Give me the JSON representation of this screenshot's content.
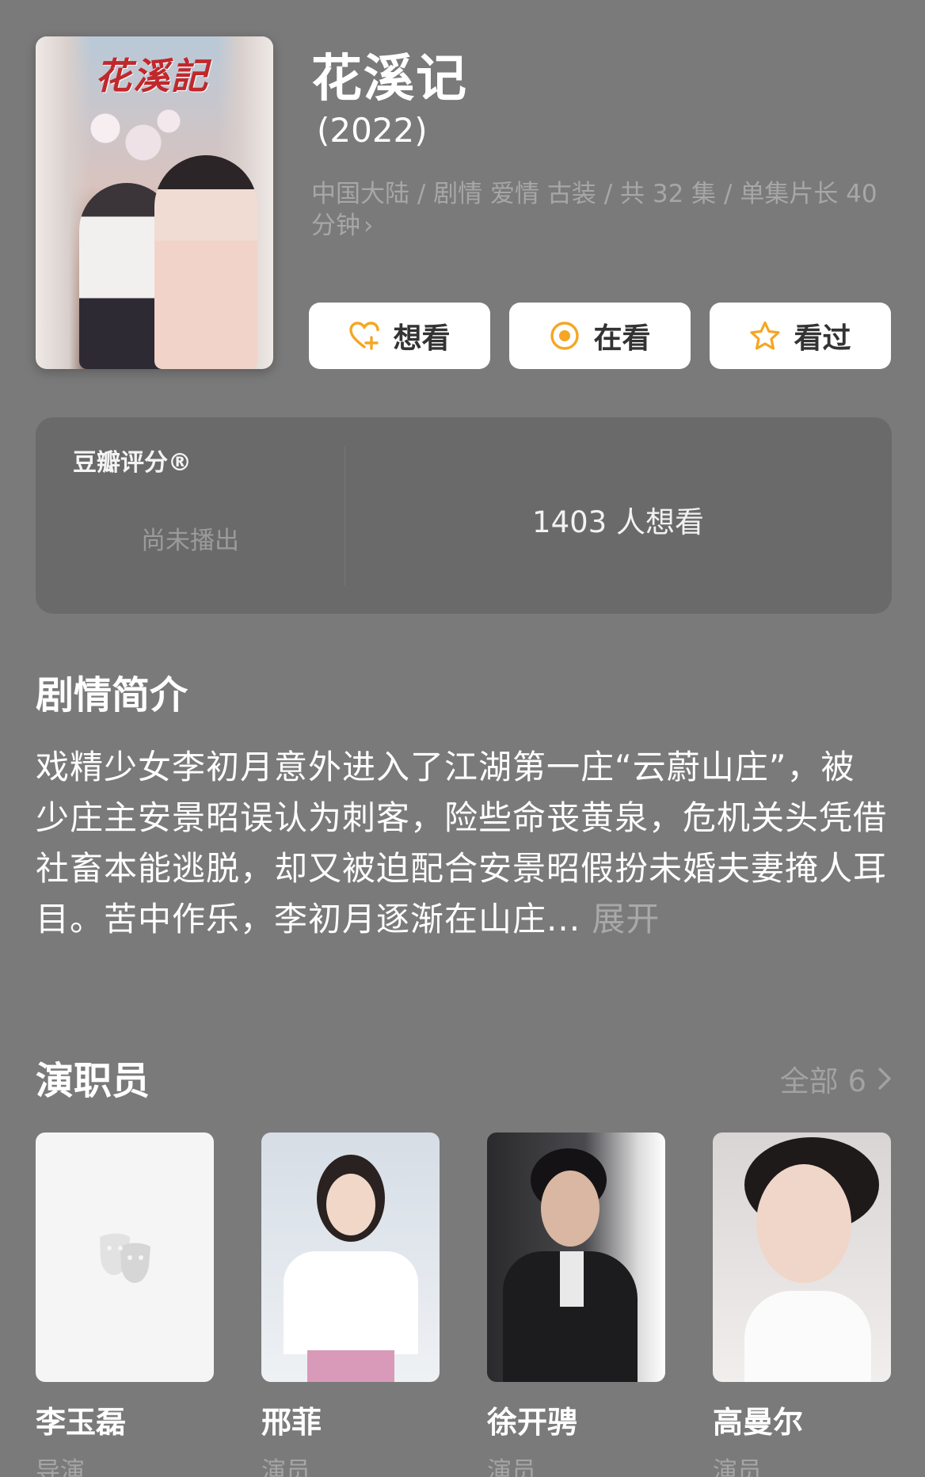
{
  "show": {
    "title": "花溪记",
    "year": "(2022)",
    "meta": "中国大陆 / 剧情 爱情 古装 / 共 32 集 / 单集片长 40 分钟",
    "poster_logo": "花溪記"
  },
  "actions": [
    {
      "label": "想看",
      "icon": "heart-plus-icon",
      "color": "#f5a623"
    },
    {
      "label": "在看",
      "icon": "target-circle-icon",
      "color": "#f5a623"
    },
    {
      "label": "看过",
      "icon": "star-outline-icon",
      "color": "#f5a623"
    }
  ],
  "rating": {
    "label": "豆瓣评分®",
    "status": "尚未播出",
    "want_count": "1403 人想看"
  },
  "synopsis": {
    "heading": "剧情简介",
    "text": "戏精少女李初月意外进入了江湖第一庄“云蔚山庄”，被少庄主安景昭误认为刺客，险些命丧黄泉，危机关头凭借社畜本能逃脱，却又被迫配合安景昭假扮未婚夫妻掩人耳目。苦中作乐，李初月逐渐在山庄...",
    "expand_label": "展开"
  },
  "cast": {
    "heading": "演职员",
    "all_label": "全部 6",
    "members": [
      {
        "name": "李玉磊",
        "role": "导演"
      },
      {
        "name": "邢菲",
        "role": "演员"
      },
      {
        "name": "徐开骋",
        "role": "演员"
      },
      {
        "name": "高曼尔",
        "role": "演员"
      }
    ]
  },
  "colors": {
    "background": "#7a7a7a",
    "card": "#6a6a6a",
    "accent": "#f5a623"
  }
}
